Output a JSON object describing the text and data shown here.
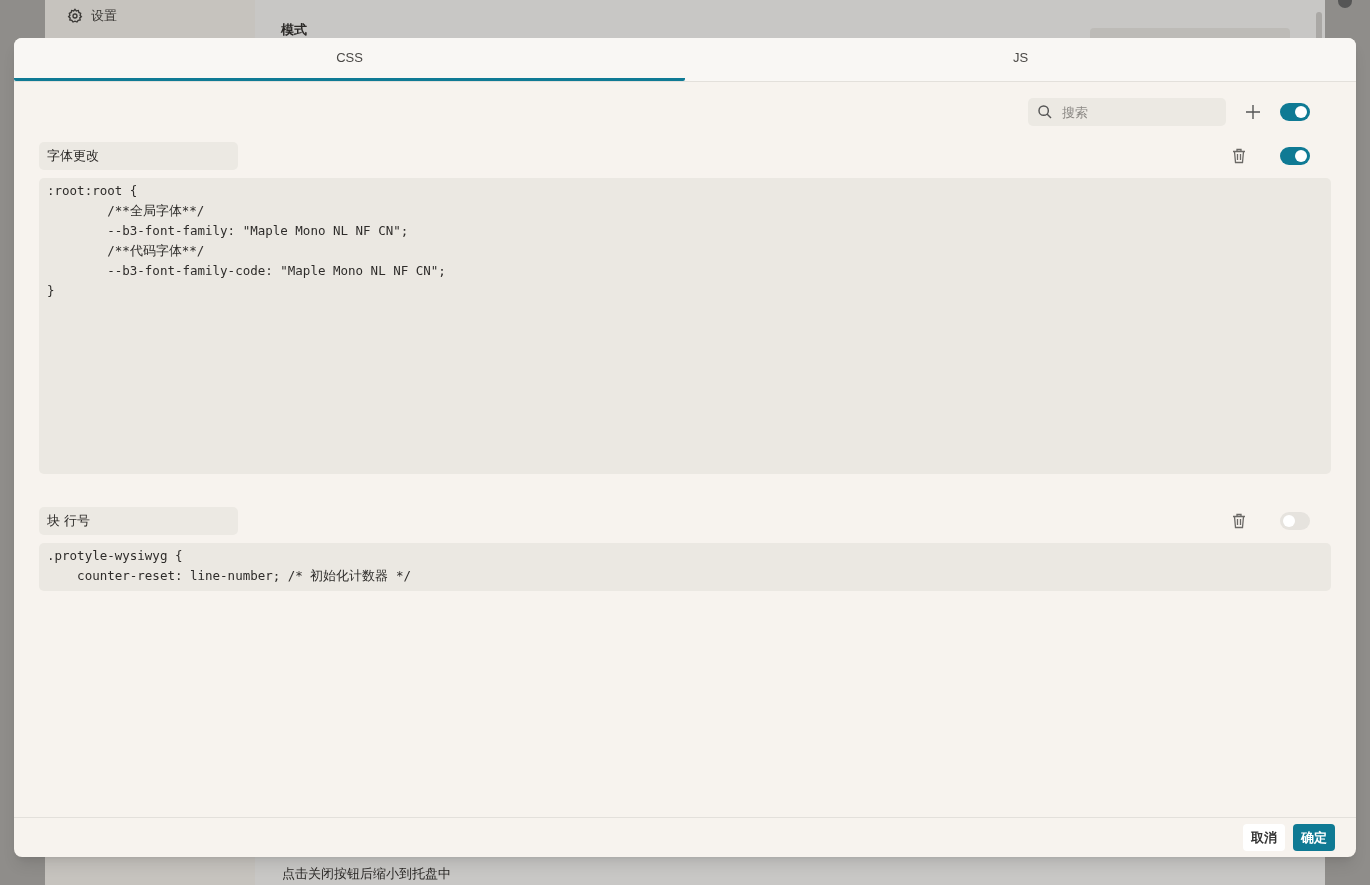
{
  "background": {
    "sidebar_item": "设置",
    "section_label": "模式",
    "footer_text": "点击关闭按钮后缩小到托盘中"
  },
  "tabs": [
    {
      "label": "CSS",
      "selected": true
    },
    {
      "label": "JS",
      "selected": false
    }
  ],
  "toolbar": {
    "search_placeholder": "搜索",
    "enabled": true
  },
  "snippets": [
    {
      "name": "字体更改",
      "enabled": true,
      "code": [
        ":root:root {",
        "        /**全局字体**/",
        "        --b3-font-family: \"Maple Mono NL NF CN\";",
        "        /**代码字体**/",
        "        --b3-font-family-code: \"Maple Mono NL NF CN\";",
        "}"
      ]
    },
    {
      "name": "块 行号",
      "enabled": false,
      "code": [
        ".protyle-wysiwyg {",
        "    counter-reset: line-number; /* 初始化计数器 */"
      ]
    }
  ],
  "buttons": [
    {
      "label": "取消",
      "kind": "secondary"
    },
    {
      "label": "确定",
      "kind": "primary"
    }
  ]
}
